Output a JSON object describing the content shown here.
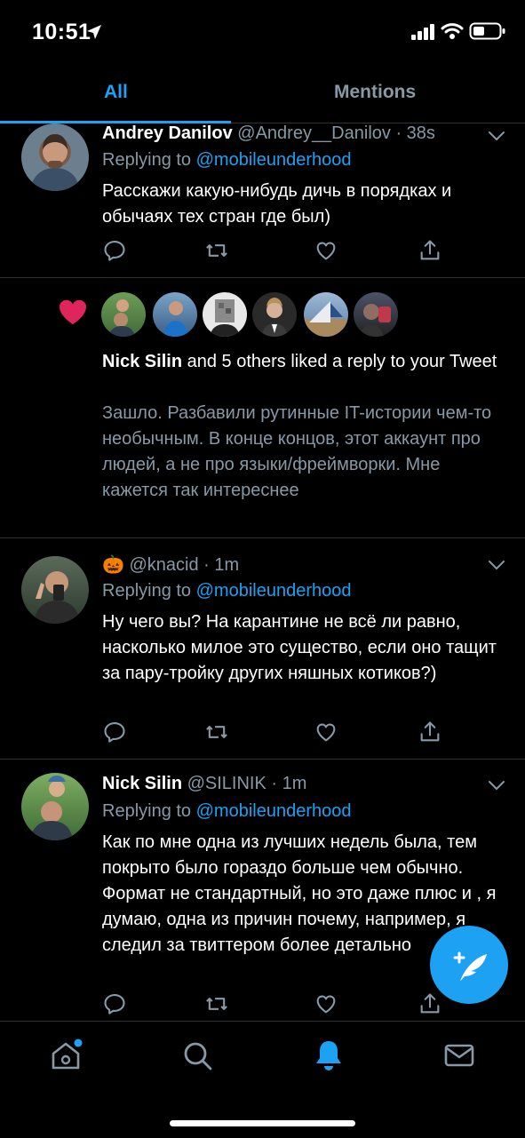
{
  "status_bar": {
    "time": "10:51"
  },
  "tabs": [
    {
      "label": "All",
      "active": true
    },
    {
      "label": "Mentions",
      "active": false
    }
  ],
  "colors": {
    "accent": "#1da1f2",
    "like": "#e0245e",
    "muted": "#8899a6",
    "divider": "#2f3336"
  },
  "notifications": [
    {
      "type": "reply",
      "name": "Andrey Danilov",
      "handle": "@Andrey__Danilov",
      "time": "· 38s",
      "replying_prefix": "Replying to",
      "replying_handle": "@mobileunderhood",
      "text": "Расскажи какую-нибудь дичь в порядках и обычаях тех стран где был)"
    },
    {
      "type": "like",
      "liker": "Nick Silin",
      "summary": "and 5 others liked a reply to your Tweet",
      "quoted_text": "Зашло. Разбавили рутинные IT-истории чем-то необычным. В конце концов, этот аккаунт про людей, а не про языки/фреймворки. Мне кажется так интереснее"
    },
    {
      "type": "reply",
      "emoji": "🎃",
      "handle": "@knacid",
      "time": "· 1m",
      "replying_prefix": "Replying to",
      "replying_handle": "@mobileunderhood",
      "text": "Ну чего вы? На карантине не всё ли равно, насколько милое это существо, если оно тащит за пару-тройку других няшных котиков?)"
    },
    {
      "type": "reply",
      "name": "Nick Silin",
      "handle": "@SILINIK",
      "time": "· 1m",
      "replying_prefix": "Replying to",
      "replying_handle": "@mobileunderhood",
      "text": "Как по мне одна из лучших недель была, тем покрыто было гораздо больше чем обычно. Формат не стандартный, но это даже плюс и , я думаю, одна из причин почему, например, я следил за твиттером более детально"
    }
  ],
  "bottom_nav": [
    {
      "icon": "home-icon",
      "badge": true
    },
    {
      "icon": "search-icon"
    },
    {
      "icon": "bell-icon",
      "active": true
    },
    {
      "icon": "mail-icon"
    }
  ],
  "fab": {
    "icon": "compose-tweet-icon"
  }
}
